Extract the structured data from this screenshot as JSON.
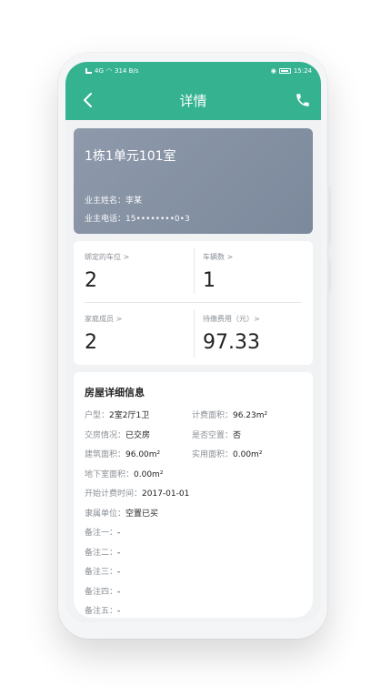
{
  "status_bar": {
    "left": "4G",
    "net_speed": "314 B/s",
    "time": "15:24"
  },
  "header": {
    "back_icon": "chevron-left-icon",
    "title": "详情",
    "phone_icon": "phone-icon"
  },
  "house": {
    "name": "1栋1单元101室",
    "owner_name": "业主姓名：李某",
    "owner_phone": "业主电话：15••••••••0•3"
  },
  "stats": {
    "parking": {
      "label": "绑定的车位 >",
      "value": "2"
    },
    "vehicles": {
      "label": "车辆数 >",
      "value": "1"
    },
    "members": {
      "label": "家庭成员 >",
      "value": "2"
    },
    "fees": {
      "label": "待缴费用（元）>",
      "value": "97.33"
    }
  },
  "details": {
    "title": "房屋详细信息",
    "layout_key": "户型：",
    "layout_val": "2室2厅1卫",
    "billing_area_key": "计费面积：",
    "billing_area_val": "96.23m²",
    "delivery_key": "交房情况：",
    "delivery_val": "已交房",
    "vacant_key": "是否空置：",
    "vacant_val": "否",
    "build_area_key": "建筑面积：",
    "build_area_val": "96.00m²",
    "use_area_key": "实用面积：",
    "use_area_val": "0.00m²",
    "basement_key": "地下室面积：",
    "basement_val": "0.00m²",
    "start_key": "开始计费时间：",
    "start_val": "2017-01-01",
    "unit_key": "隶属单位：",
    "unit_val": "空置已买",
    "note1_key": "备注一：",
    "note1_val": "-",
    "note2_key": "备注二：",
    "note2_val": "-",
    "note3_key": "备注三：",
    "note3_val": "-",
    "note4_key": "备注四：",
    "note4_val": "-",
    "note5_key": "备注五：",
    "note5_val": "-"
  },
  "colors": {
    "brand": "#35b391",
    "card_gray": "#8794a6"
  }
}
